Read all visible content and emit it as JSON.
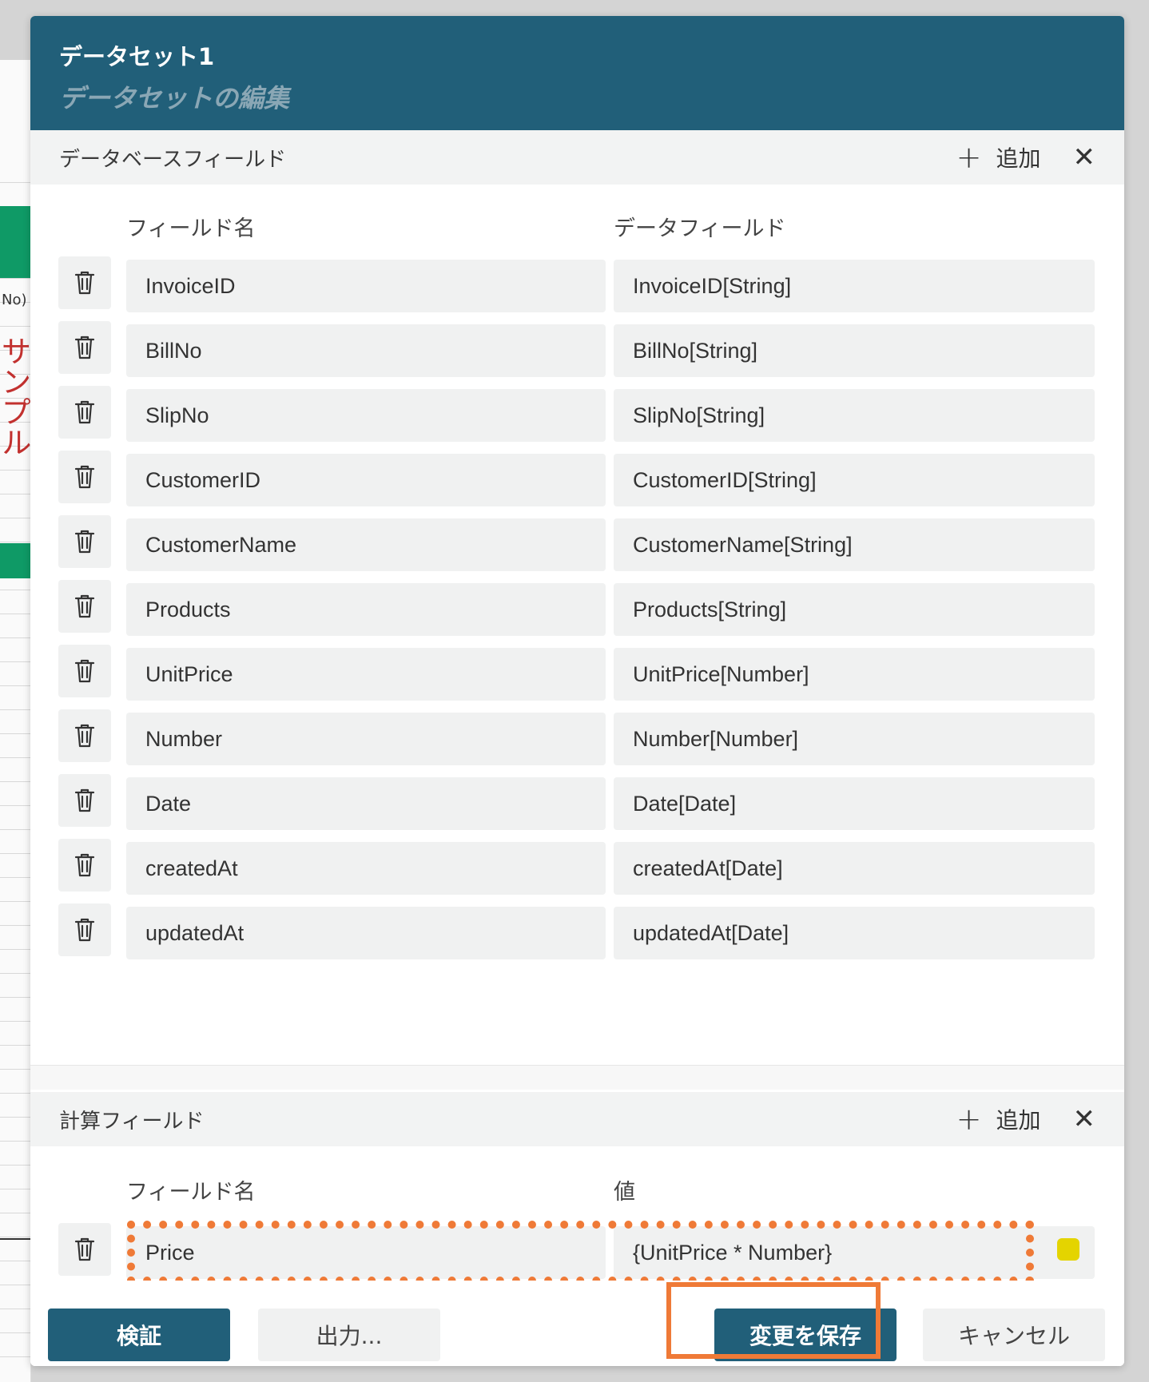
{
  "background": {
    "sheet_text": "No)",
    "sheet_red_text": "サンプル"
  },
  "dialog": {
    "title": "データセット1",
    "subtitle": "データセットの編集"
  },
  "db_fields": {
    "section_label": "データベースフィールド",
    "add_label": "追加",
    "close_symbol": "✕",
    "plus_symbol": "+",
    "col_name": "フィールド名",
    "col_data": "データフィールド",
    "rows": [
      {
        "name": "InvoiceID",
        "data": "InvoiceID[String]"
      },
      {
        "name": "BillNo",
        "data": "BillNo[String]"
      },
      {
        "name": "SlipNo",
        "data": "SlipNo[String]"
      },
      {
        "name": "CustomerID",
        "data": "CustomerID[String]"
      },
      {
        "name": "CustomerName",
        "data": "CustomerName[String]"
      },
      {
        "name": "Products",
        "data": "Products[String]"
      },
      {
        "name": "UnitPrice",
        "data": "UnitPrice[Number]"
      },
      {
        "name": "Number",
        "data": "Number[Number]"
      },
      {
        "name": "Date",
        "data": "Date[Date]"
      },
      {
        "name": "createdAt",
        "data": "createdAt[Date]"
      },
      {
        "name": "updatedAt",
        "data": "updatedAt[Date]"
      }
    ]
  },
  "calc_fields": {
    "section_label": "計算フィールド",
    "add_label": "追加",
    "close_symbol": "✕",
    "plus_symbol": "+",
    "col_name": "フィールド名",
    "col_value": "値",
    "rows": [
      {
        "name": "Price",
        "value": "{UnitPrice * Number}"
      }
    ]
  },
  "footer": {
    "validate_label": "検証",
    "export_label": "出力...",
    "save_label": "変更を保存",
    "cancel_label": "キャンセル"
  },
  "colors": {
    "header": "#215f79",
    "highlight": "#ef7a37",
    "status_dot": "#e4d400"
  }
}
